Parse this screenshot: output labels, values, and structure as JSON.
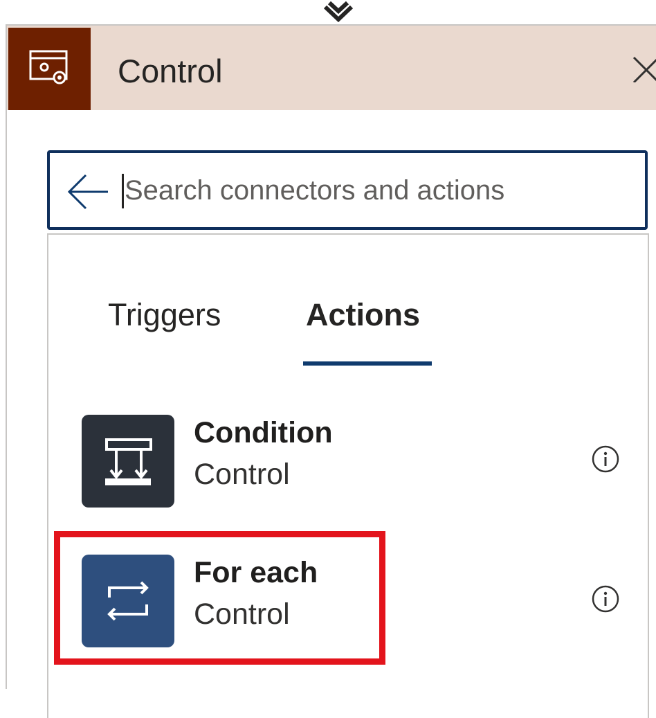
{
  "panel": {
    "title": "Control",
    "header_icon": "control-gear-icon",
    "close_icon": "close-icon",
    "colors": {
      "header_bg": "#ead9cf",
      "icon_bg": "#6e2000"
    }
  },
  "search": {
    "placeholder": "Search connectors and actions",
    "value": "",
    "back_icon": "back-arrow-icon"
  },
  "tabs": [
    {
      "label": "Triggers",
      "selected": false
    },
    {
      "label": "Actions",
      "selected": true
    }
  ],
  "actions": [
    {
      "title": "Condition",
      "subtitle": "Control",
      "icon": "condition-icon",
      "color": "#2b313a"
    },
    {
      "title": "For each",
      "subtitle": "Control",
      "icon": "loop-icon",
      "color": "#2e4f7e",
      "highlighted": true
    }
  ],
  "colors": {
    "accent": "#0f3b6e",
    "highlight": "#e3141c"
  }
}
